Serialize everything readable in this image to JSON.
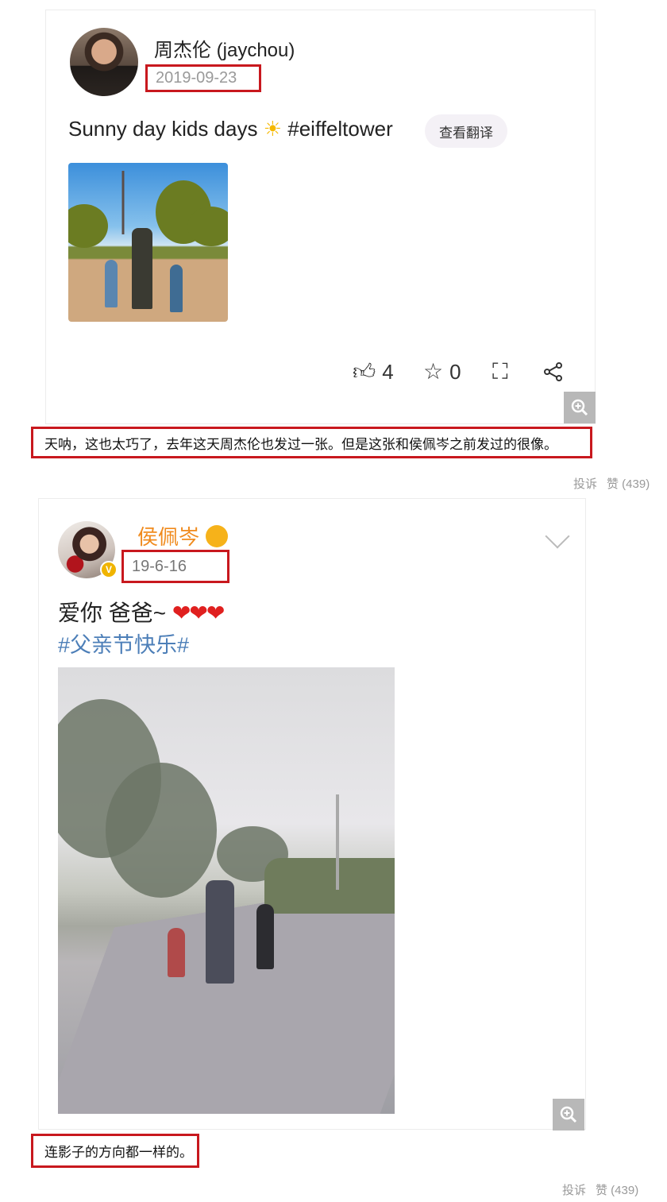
{
  "post1": {
    "username": "周杰伦 (jaychou)",
    "date": "2019-09-23",
    "text": "Sunny day kids days",
    "emoji": "☀",
    "hashtag": "#eiffeltower",
    "translate_label": "查看翻译",
    "likes": "4",
    "favorites": "0",
    "icons": [
      "thumbs-up-icon",
      "star-icon",
      "expand-icon",
      "share-icon"
    ]
  },
  "caption1": {
    "text": "天呐，这也太巧了，去年这天周杰伦也发过一张。但是这张和侯佩岑之前发过的很像。",
    "report_label": "投诉",
    "like_label": "赞 (439)"
  },
  "post2": {
    "username": "侯佩岑",
    "date": "19-6-16",
    "text": "爱你 爸爸~",
    "hearts": "❤❤❤",
    "hashtag": "#父亲节快乐#",
    "verified_badge": "V"
  },
  "caption2": {
    "text": "连影子的方向都一样的。",
    "report_label": "投诉",
    "like_label": "赞 (439)"
  },
  "colors": {
    "highlight_border": "#c8181e",
    "orange_username": "#f08a1c",
    "hashtag_blue": "#4d7fb8"
  }
}
